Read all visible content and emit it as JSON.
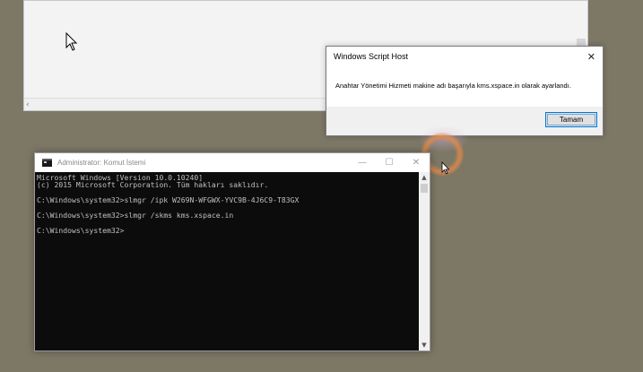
{
  "wsh_dialog": {
    "title": "Windows Script Host",
    "close_glyph": "✕",
    "message": "Anahtar Yönetimi Hizmeti makine adı başarıyla kms.xspace.in olarak ayarlandı.",
    "ok_label": "Tamam"
  },
  "cmd_window": {
    "title": "Administrator: Komut İstemi",
    "minimize_glyph": "—",
    "maximize_glyph": "☐",
    "close_glyph": "✕",
    "lines": [
      "Microsoft Windows [Version 10.0.10240]",
      "(c) 2015 Microsoft Corporation. Tüm hakları saklıdır.",
      "",
      "C:\\Windows\\system32>slmgr /ipk W269N-WFGWX-YVC9B-4J6C9-T83GX",
      "",
      "C:\\Windows\\system32>slmgr /skms kms.xspace.in",
      "",
      "C:\\Windows\\system32>"
    ]
  },
  "icons": {
    "pointer": "mouse-pointer-icon",
    "cmd_app": "console-icon",
    "scroll_up": "▲",
    "scroll_down": "▼",
    "scroll_left": "‹"
  },
  "colors": {
    "desktop": "#7d7766",
    "console_bg": "#0c0c0c",
    "console_text": "#c0c0c0",
    "dialog_button_border": "#0078d7"
  }
}
